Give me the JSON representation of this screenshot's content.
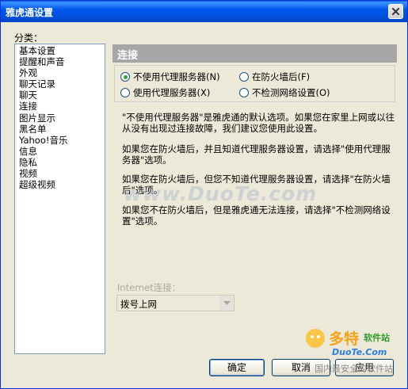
{
  "window": {
    "title": "雅虎通设置"
  },
  "sidebar": {
    "label": "分类：",
    "items": [
      "基本设置",
      "提醒和声音",
      "外观",
      "聊天记录",
      "聊天",
      "连接",
      "图片显示",
      "黑名单",
      "Yahoo!音乐",
      "信息",
      "隐私",
      "视频",
      "超级视频"
    ]
  },
  "section": {
    "title": "连接"
  },
  "options": {
    "no_proxy": "不使用代理服务器(N)",
    "behind_firewall": "在防火墙后(F)",
    "use_proxy": "使用代理服务器(X)",
    "no_network_check": "不检测网络设置(O)",
    "selected": "no_proxy"
  },
  "descriptions": [
    "\"不使用代理服务器\"是雅虎通的默认选项。如果您在家里上网或以往从没有出现过连接故障，我们建议您使用此设置。",
    "如果您在防火墙后，并且知道代理服务器设置，请选择\"使用代理服务器\"选项。",
    "如果您在防火墙后，但您不知道代理服务器设置，请选择\"在防火墙后\"选项。",
    "如果您不在防火墙后，但是雅虎通无法连接，请选择\"不检测网络设置\"选项。"
  ],
  "internet": {
    "label": "Internet连接：",
    "value": "拨号上网"
  },
  "buttons": {
    "ok": "确定",
    "cancel": "取消",
    "apply": "应用"
  },
  "watermarks": {
    "center": "www.DuoTe.com",
    "logo_line1": "多特",
    "logo_line1b": "软件站",
    "logo_line2": "DuoTe.Com",
    "logo_line3": "国内最安全的软件站"
  }
}
